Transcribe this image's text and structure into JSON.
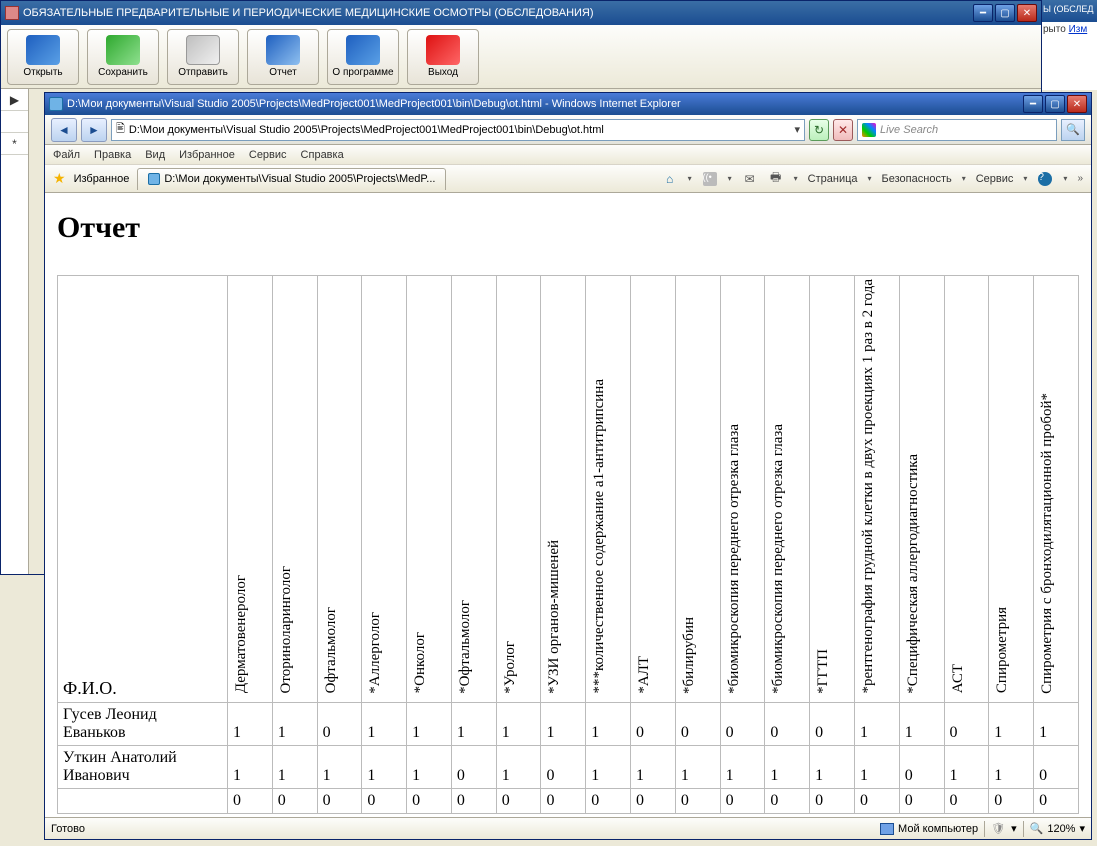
{
  "bg_peek": {
    "title": "Ы (ОБСЛЕД",
    "line": "рыто",
    "link": "Изм"
  },
  "app": {
    "title": "ОБЯЗАТЕЛЬНЫЕ ПРЕДВАРИТЕЛЬНЫЕ И ПЕРИОДИЧЕСКИЕ МЕДИЦИНСКИЕ ОСМОТРЫ (ОБСЛЕДОВАНИЯ)",
    "toolbar": {
      "open": "Открыть",
      "save": "Сохранить",
      "send": "Отправить",
      "report": "Отчет",
      "about": "О программе",
      "exit": "Выход"
    },
    "left_markers": [
      "▶",
      "",
      "*"
    ]
  },
  "ie": {
    "title": "D:\\Мои документы\\Visual Studio 2005\\Projects\\MedProject001\\MedProject001\\bin\\Debug\\ot.html - Windows Internet Explorer",
    "address": "D:\\Мои документы\\Visual Studio 2005\\Projects\\MedProject001\\MedProject001\\bin\\Debug\\ot.html",
    "search_placeholder": "Live Search",
    "menu": {
      "file": "Файл",
      "edit": "Правка",
      "view": "Вид",
      "favorites": "Избранное",
      "tools": "Сервис",
      "help": "Справка"
    },
    "favbar": {
      "fav": "Избранное",
      "tab": "D:\\Мои документы\\Visual Studio 2005\\Projects\\MedP...",
      "page": "Страница",
      "safety": "Безопасность",
      "service": "Сервис"
    },
    "status": {
      "ready": "Готово",
      "zone": "Мой компьютер",
      "zoom": "120%"
    }
  },
  "report": {
    "title": "Отчет",
    "fio_header": "Ф.И.О.",
    "columns": [
      "Дерматовенеролог",
      "Оториноларинголог",
      "Офтальмолог",
      "*Аллерголог",
      "*Онколог",
      "*Офтальмолог",
      "*Уролог",
      "*УЗИ органов-мишеней",
      "***количественное содержание a1-антитрипсина",
      "*АЛТ",
      "*билирубин",
      "*биомикроскопия переднего отрезка глаза",
      "*биомикроскопия переднего отрезка глаза",
      "*ГГТП",
      "*рентгенография грудной клетки в двух проекциях 1 раз в 2 года",
      "*Специфическая аллергодиагностика",
      "АСТ",
      "Спирометрия",
      "Спирометрия с бронходилятационной пробой*"
    ],
    "rows": [
      {
        "name": "Гусев Леонид Еваньков",
        "v": [
          1,
          1,
          0,
          1,
          1,
          1,
          1,
          1,
          1,
          0,
          0,
          0,
          0,
          0,
          1,
          1,
          0,
          1,
          1
        ]
      },
      {
        "name": "Уткин Анатолий Иванович",
        "v": [
          1,
          1,
          1,
          1,
          1,
          0,
          1,
          0,
          1,
          1,
          1,
          1,
          1,
          1,
          1,
          0,
          1,
          1,
          0
        ]
      },
      {
        "name": "",
        "v": [
          0,
          0,
          0,
          0,
          0,
          0,
          0,
          0,
          0,
          0,
          0,
          0,
          0,
          0,
          0,
          0,
          0,
          0,
          0
        ]
      }
    ]
  }
}
